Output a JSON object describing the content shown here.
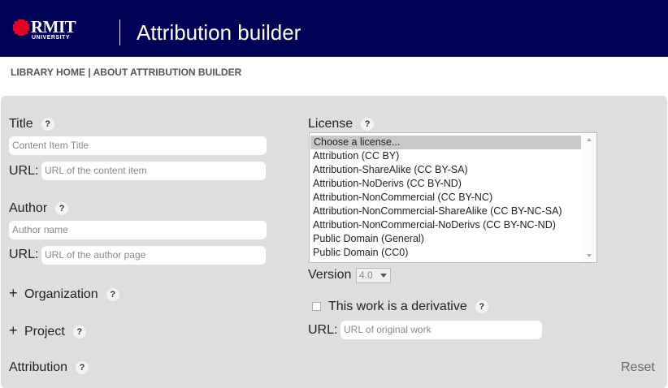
{
  "header": {
    "logo_text": "RMIT",
    "logo_sub": "UNIVERSITY",
    "title": "Attribution builder"
  },
  "nav": {
    "home": "LIBRARY HOME",
    "separator": " | ",
    "about": "ABOUT ATTRIBUTION BUILDER"
  },
  "help_glyph": "?",
  "title_section": {
    "label": "Title",
    "title_placeholder": "Content Item Title",
    "url_label": "URL:",
    "url_placeholder": "URL of the content item"
  },
  "author_section": {
    "label": "Author",
    "name_placeholder": "Author name",
    "url_label": "URL:",
    "url_placeholder": "URL of the author page"
  },
  "organization": {
    "label": "Organization",
    "expander": "+"
  },
  "project": {
    "label": "Project",
    "expander": "+"
  },
  "attribution": {
    "label": "Attribution"
  },
  "license_section": {
    "label": "License",
    "options": [
      "Choose a license...",
      "Attribution (CC BY)",
      "Attribution-ShareAlike (CC BY-SA)",
      "Attribution-NoDerivs (CC BY-ND)",
      "Attribution-NonCommercial (CC BY-NC)",
      "Attribution-NonCommercial-ShareAlike (CC BY-NC-SA)",
      "Attribution-NonCommercial-NoDerivs (CC BY-NC-ND)",
      "Public Domain (General)",
      "Public Domain (CC0)"
    ],
    "version_label": "Version",
    "version_value": "4.0",
    "derivative_label": "This work is a derivative",
    "url_label": "URL:",
    "url_placeholder": "URL of original work"
  },
  "reset_label": "Reset",
  "colors": {
    "header_bg": "#000054",
    "logo_red": "#e60028",
    "panel_bg": "#dedede"
  }
}
